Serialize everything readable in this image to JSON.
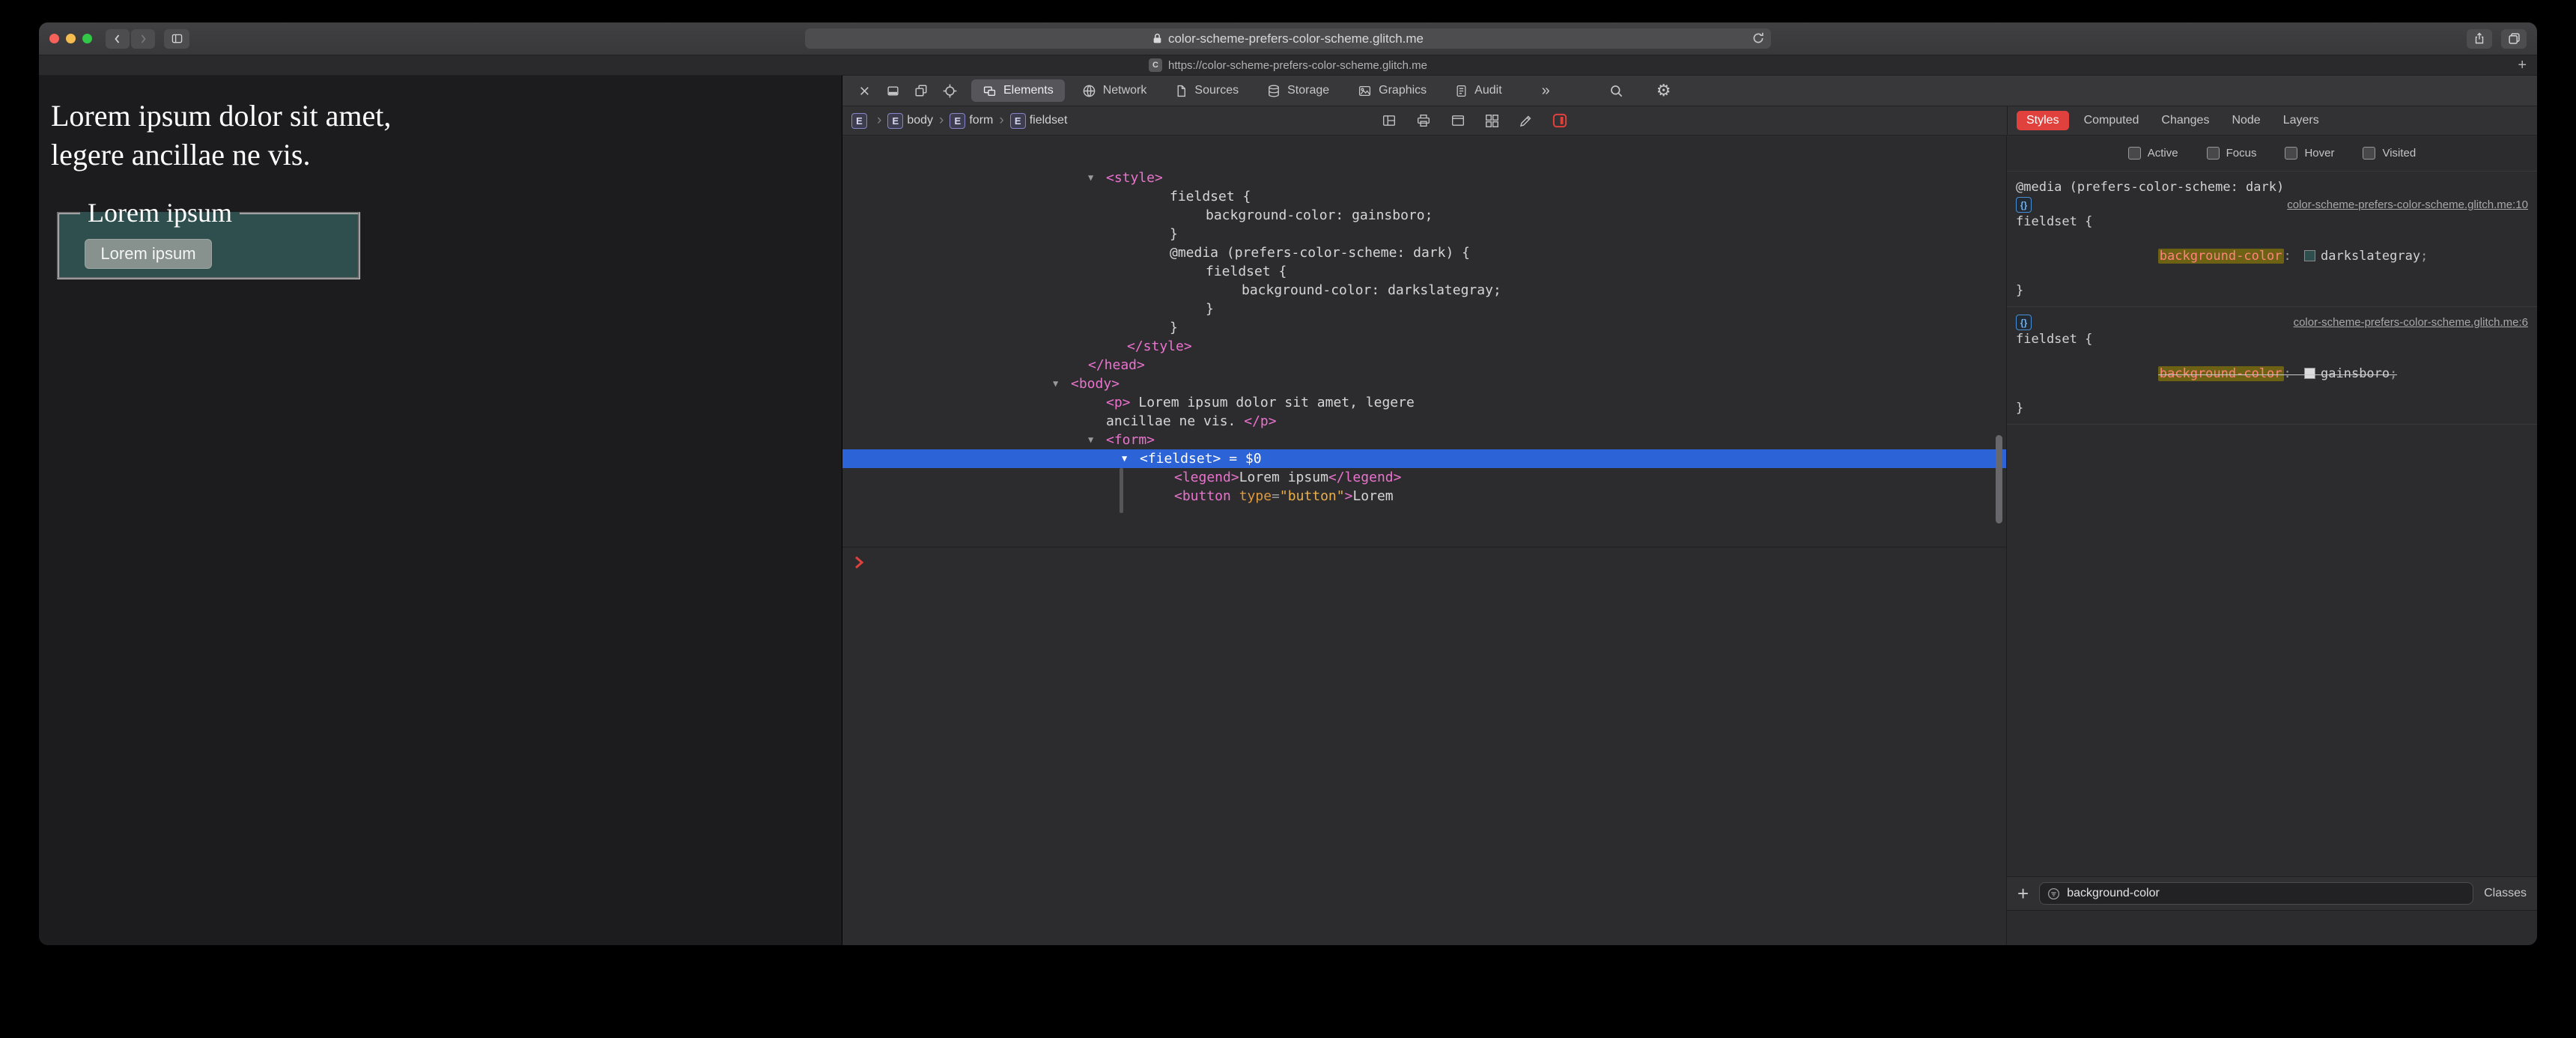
{
  "window": {
    "url_bar_text": "color-scheme-prefers-color-scheme.glitch.me",
    "tab_title": "https://color-scheme-prefers-color-scheme.glitch.me",
    "tab_favicon_letter": "C",
    "new_tab_label": "+"
  },
  "colors": {
    "selection_blue": "#2C63D6",
    "styles_tab_red": "#E0413C",
    "tag_pink": "#EA73CE",
    "attr_orange": "#E8A33D",
    "page_bg": "#1C1C1E",
    "fieldset_bg": "#2F4F4F",
    "match_highlight": "#6D6214"
  },
  "page": {
    "paragraph": "Lorem ipsum dolor sit amet, legere ancillae ne vis.",
    "fieldset_legend": "Lorem ipsum",
    "button_label": "Lorem ipsum"
  },
  "inspector": {
    "tabs": [
      {
        "label": "Elements",
        "selected": true
      },
      {
        "label": "Network",
        "selected": false
      },
      {
        "label": "Sources",
        "selected": false
      },
      {
        "label": "Storage",
        "selected": false
      },
      {
        "label": "Graphics",
        "selected": false
      },
      {
        "label": "Audit",
        "selected": false
      }
    ],
    "overflow_chevron": "»",
    "breadcrumb": [
      {
        "badge": "E",
        "label": ""
      },
      {
        "badge": "E",
        "label": "body"
      },
      {
        "badge": "E",
        "label": "form"
      },
      {
        "badge": "E",
        "label": "fieldset"
      }
    ],
    "dom_tree": {
      "lines": [
        {
          "indent": 352,
          "tri": true,
          "tokens": [
            {
              "c": "tag",
              "s": "<style>"
            }
          ]
        },
        {
          "indent": 437,
          "tokens": [
            {
              "c": "txt",
              "s": "fieldset {"
            }
          ]
        },
        {
          "indent": 485,
          "tokens": [
            {
              "c": "txt",
              "s": "background-color: gainsboro;"
            }
          ]
        },
        {
          "indent": 437,
          "tokens": [
            {
              "c": "txt",
              "s": "}"
            }
          ]
        },
        {
          "indent": 437,
          "tokens": [
            {
              "c": "txt",
              "s": "@media (prefers-color-scheme: dark) {"
            }
          ]
        },
        {
          "indent": 485,
          "tokens": [
            {
              "c": "txt",
              "s": "fieldset {"
            }
          ]
        },
        {
          "indent": 533,
          "tokens": [
            {
              "c": "txt",
              "s": "background-color: darkslategray;"
            }
          ]
        },
        {
          "indent": 485,
          "tokens": [
            {
              "c": "txt",
              "s": "}"
            }
          ]
        },
        {
          "indent": 437,
          "tokens": [
            {
              "c": "txt",
              "s": "}"
            }
          ]
        },
        {
          "indent": 380,
          "tokens": [
            {
              "c": "tag",
              "s": "</style>"
            }
          ]
        },
        {
          "indent": 328,
          "tokens": [
            {
              "c": "tag",
              "s": "</head>"
            }
          ]
        },
        {
          "indent": 305,
          "tri": true,
          "tokens": [
            {
              "c": "tag",
              "s": "<body>"
            }
          ]
        },
        {
          "indent": 352,
          "tokens": [
            {
              "c": "tag",
              "s": "<p>"
            },
            {
              "c": "txt",
              "s": " Lorem ipsum dolor sit amet, legere"
            }
          ]
        },
        {
          "indent": 352,
          "tokens": [
            {
              "c": "txt",
              "s": "ancillae ne vis. "
            },
            {
              "c": "tag",
              "s": "</p>"
            }
          ]
        },
        {
          "indent": 352,
          "tri": true,
          "tokens": [
            {
              "c": "tag",
              "s": "<form>"
            }
          ]
        },
        {
          "indent": 397,
          "tri": true,
          "selected": true,
          "tokens": [
            {
              "c": "tag",
              "s": "<fieldset>"
            },
            {
              "c": "txt",
              "s": " = $0"
            }
          ]
        },
        {
          "indent": 443,
          "tokens": [
            {
              "c": "tag",
              "s": "<legend>"
            },
            {
              "c": "txt",
              "s": "Lorem ipsum"
            },
            {
              "c": "tag",
              "s": "</legend>"
            }
          ]
        },
        {
          "indent": 443,
          "tokens": [
            {
              "c": "tag",
              "s": "<button"
            },
            {
              "c": "attrn",
              "s": " type"
            },
            {
              "c": "punct",
              "s": "="
            },
            {
              "c": "attrv",
              "s": "\"button\""
            },
            {
              "c": "tag",
              "s": ">"
            },
            {
              "c": "txt",
              "s": "Lorem"
            }
          ]
        }
      ]
    }
  },
  "styles_panel": {
    "tabs": [
      {
        "label": "Styles",
        "selected": true
      },
      {
        "label": "Computed",
        "selected": false
      },
      {
        "label": "Changes",
        "selected": false
      },
      {
        "label": "Node",
        "selected": false
      },
      {
        "label": "Layers",
        "selected": false
      }
    ],
    "pseudo_classes": [
      "Active",
      "Focus",
      "Hover",
      "Visited"
    ],
    "rule1": {
      "media": "@media (prefers-color-scheme: dark)",
      "icon": "{}",
      "link": "color-scheme-prefers-color-scheme.glitch.me:10",
      "selector_open": "fieldset {",
      "property": "background-color",
      "colon": ": ",
      "value": "darkslategray",
      "semicolon": ";",
      "swatch": "#2F4F4F",
      "close": "}"
    },
    "rule2": {
      "icon": "{}",
      "link": "color-scheme-prefers-color-scheme.glitch.me:6",
      "selector_open": "fieldset {",
      "property": "background-color",
      "colon": ": ",
      "value": "gainsboro",
      "semicolon": ";",
      "swatch": "#DCDCDC",
      "close": "}"
    },
    "footer": {
      "add_label": "+",
      "filter_value": "background-color",
      "classes_label": "Classes"
    }
  }
}
